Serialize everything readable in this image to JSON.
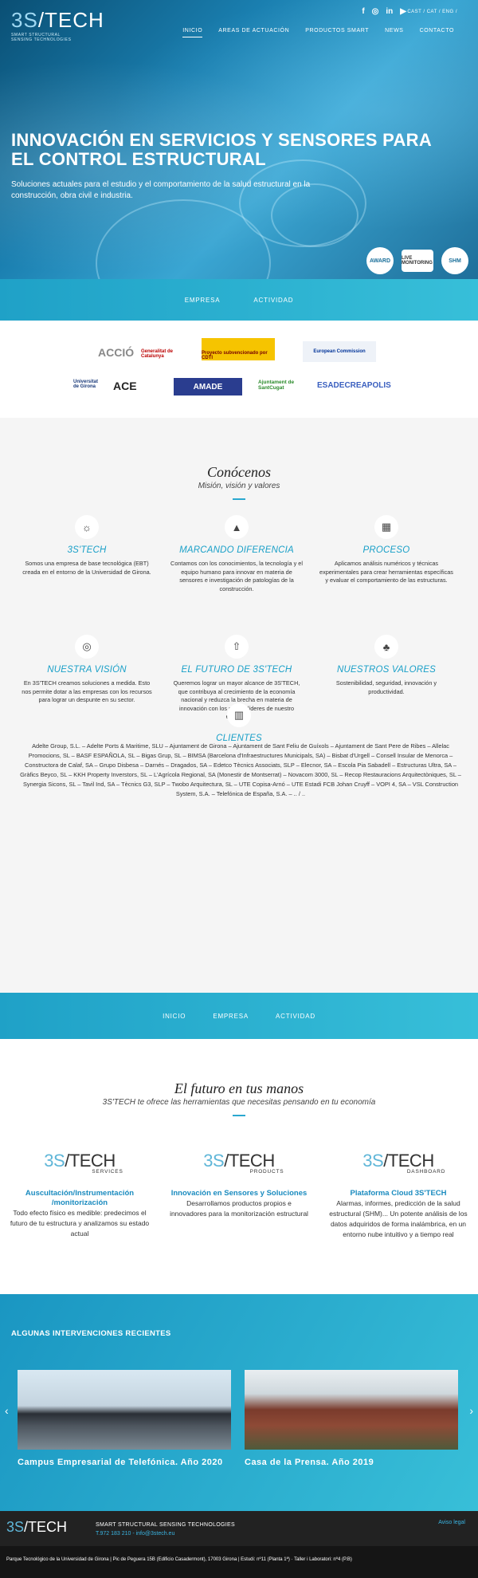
{
  "header": {
    "logo_main": "3S",
    "logo_main2": "TECH",
    "logo_sub1": "SMART STRUCTURAL",
    "logo_sub2": "SENSING TECHNOLOGIES",
    "social": [
      "f",
      "◎",
      "in",
      "▶"
    ],
    "lang": "CAST / CAT / ENG /",
    "nav": [
      "INICIO",
      "AREAS DE ACTUACIÓN",
      "PRODUCTOS SMART",
      "NEWS",
      "CONTACTO"
    ]
  },
  "hero": {
    "title": "INNOVACIÓN EN SERVICIOS Y SENSORES PARA EL CONTROL ESTRUCTURAL",
    "subtitle": "Soluciones actuales para el estudio y el comportamiento de la salud estructural en la construcción, obra civil e industria.",
    "badges": [
      "AWARD",
      "LIVE MONITORING",
      "SHM"
    ]
  },
  "band1": [
    "EMPRESA",
    "ACTIVIDAD"
  ],
  "partners": [
    "ACCIÓ",
    "Generalitat de Catalunya",
    "Proyecto subvencionado por CDTI",
    "European Commission",
    "Universitat de Girona",
    "ACE",
    "AMADE",
    "Ajuntament de SantCugat",
    "ESADECREAPOLIS"
  ],
  "about": {
    "title": "Conócenos",
    "subtitle": "Misión, visión y valores",
    "items": [
      {
        "title": "3S'TECH",
        "text": "Somos una empresa de base tecnológica (EBT) creada en el entorno de la Universidad de Girona."
      },
      {
        "title": "MARCANDO DIFERENCIA",
        "text": "Contamos con los conocimientos, la tecnología y el equipo humano para innovar en materia de sensores e investigación de patologías de la construcción."
      },
      {
        "title": "PROCESO",
        "text": "Aplicamos análisis numéricos y técnicas experimentales para crear herramientas específicas y evaluar el comportamiento de las estructuras."
      },
      {
        "title": "NUESTRA VISIÓN",
        "text": "En 3S'TECH creamos soluciones a medida. Esto nos permite dotar a las empresas con los recursos para lograr un despunte en su sector."
      },
      {
        "title": "EL FUTURO DE 3S'TECH",
        "text": "Queremos lograr un mayor alcance de 3S'TECH, que contribuya al crecimiento de la economía nacional y reduzca la brecha en materia de innovación con los países líderes de nuestro entorno."
      },
      {
        "title": "NUESTROS VALORES",
        "text": "Sostenibilidad, seguridad, innovación y productividad."
      }
    ],
    "clients_title": "CLIENTES",
    "clients_text": "Adelte Group, S.L. – Adelte Ports & Maritime, SLU – Ajuntament de Girona – Ajuntament de Sant Feliu de Guíxols – Ajuntament de Sant Pere de Ribes – Allelac Promocions, SL – BASF ESPAÑOLA, SL – Bigas Grup, SL – BIMSA (Barcelona d'Infraestructures Municipals, SA) – Bisbat d'Urgell – Consell Insular de Menorca – Constructora de Calaf, SA – Grupo Disbesa – Darnés – Dragados, SA – Edetco Tècnics Associats, SLP – Elecnor, SA – Escola Pia Sabadell – Estructuras Ultra, SA – Gràfics Beyco, SL – KKH Property Inverstors, SL – L'Agrícola Regional, SA (Monestir de Montserrat) – Novacom 3000, SL – Recop Restauracions Arquitectòniques, SL – Synergia Sicons, SL – Tavil Ind, SA – Tècnics G3, SLP – Twobo Arquitectura, SL – UTE Copisa-Arnó – UTE Estadi FCB Johan Cruyff – VOPI 4, SA – VSL Construction System, S.A. – Telefónica de España, S.A. – .. / .."
  },
  "band2": [
    "INICIO",
    "EMPRESA",
    "ACTIVIDAD"
  ],
  "future": {
    "title": "El futuro en tus manos",
    "subtitle": "3S'TECH te ofrece las herramientas que necesitas pensando en tu economía",
    "products": [
      {
        "sub": "SERVICES",
        "title": "Auscultación/Instrumentación /monitorización",
        "text": "Todo efecto físico es medible: predecimos el futuro de tu estructura y analizamos su estado actual"
      },
      {
        "sub": "PRODUCTS",
        "title": "Innovación en Sensores y Soluciones",
        "text": "Desarrollamos productos propios e innovadores para la monitorización estructural"
      },
      {
        "sub": "DASHBOARD",
        "title": "Plataforma Cloud 3S'TECH",
        "text": "Alarmas, informes, predicción de la salud estructural (SHM)... Un potente análisis de los datos adquiridos de forma inalámbrica, en un entorno nube intuitivo y a tiempo real"
      }
    ]
  },
  "recent": {
    "title": "ALGUNAS INTERVENCIONES RECIENTES",
    "cards": [
      "Campus Empresarial de Telefónica. Año 2020",
      "Casa de la Prensa. Año 2019"
    ]
  },
  "footer": {
    "tagline": "SMART STRUCTURAL SENSING TECHNOLOGIES",
    "contact": "T.972 183 210 - info@3stech.eu",
    "legal": "Aviso legal",
    "address": "Parque Tecnológico de la Universidad de Girona | Pic de Peguera 15B (Edificio Casadermont), 17003 Girona | Estudi: nº11 (Planta 1ª) · Taller i Laboratori: nº4 (P.B)"
  }
}
